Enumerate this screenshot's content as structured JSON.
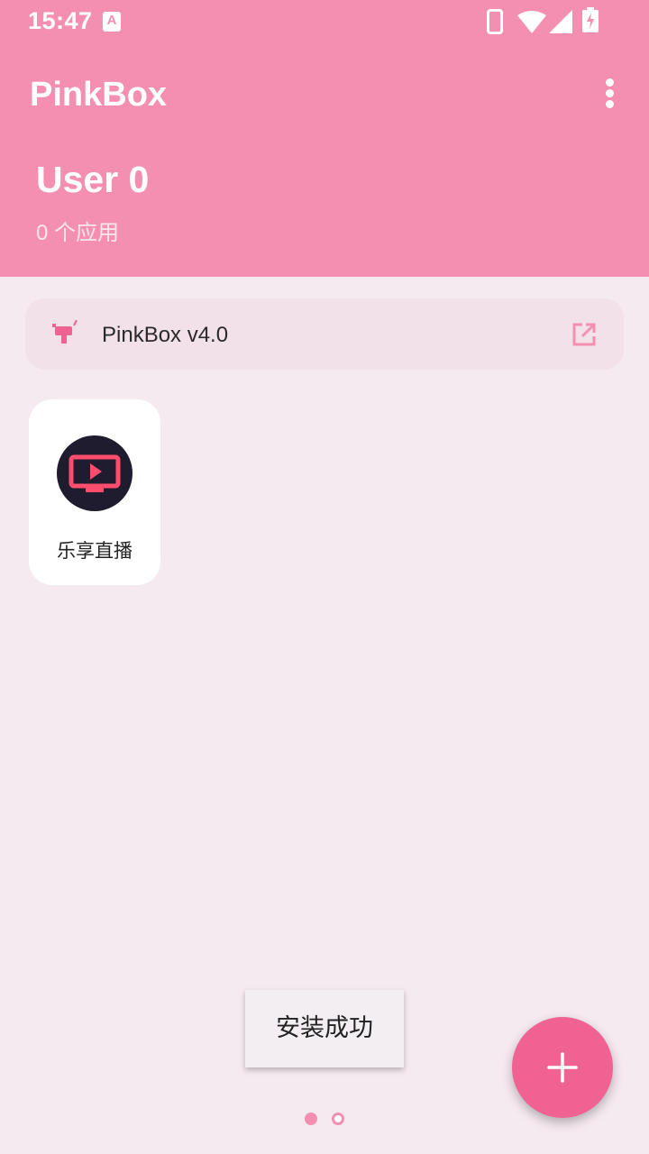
{
  "status_bar": {
    "time": "15:47",
    "notification_letter": "A"
  },
  "app_bar": {
    "title": "PinkBox"
  },
  "user": {
    "name": "User 0",
    "app_count": "0 个应用"
  },
  "version_card": {
    "label": "PinkBox v4.0"
  },
  "apps": [
    {
      "label": "乐享直播",
      "icon": "tv-play-icon"
    }
  ],
  "toast": {
    "message": "安装成功"
  },
  "pager": {
    "page_count": 2,
    "current_page": 1
  },
  "colors": {
    "primary": "#f48fb1",
    "fab": "#f06292",
    "background": "#f5eaf0",
    "app_icon_bg": "#1e1c2e",
    "app_icon_accent": "#ff4d6d"
  }
}
